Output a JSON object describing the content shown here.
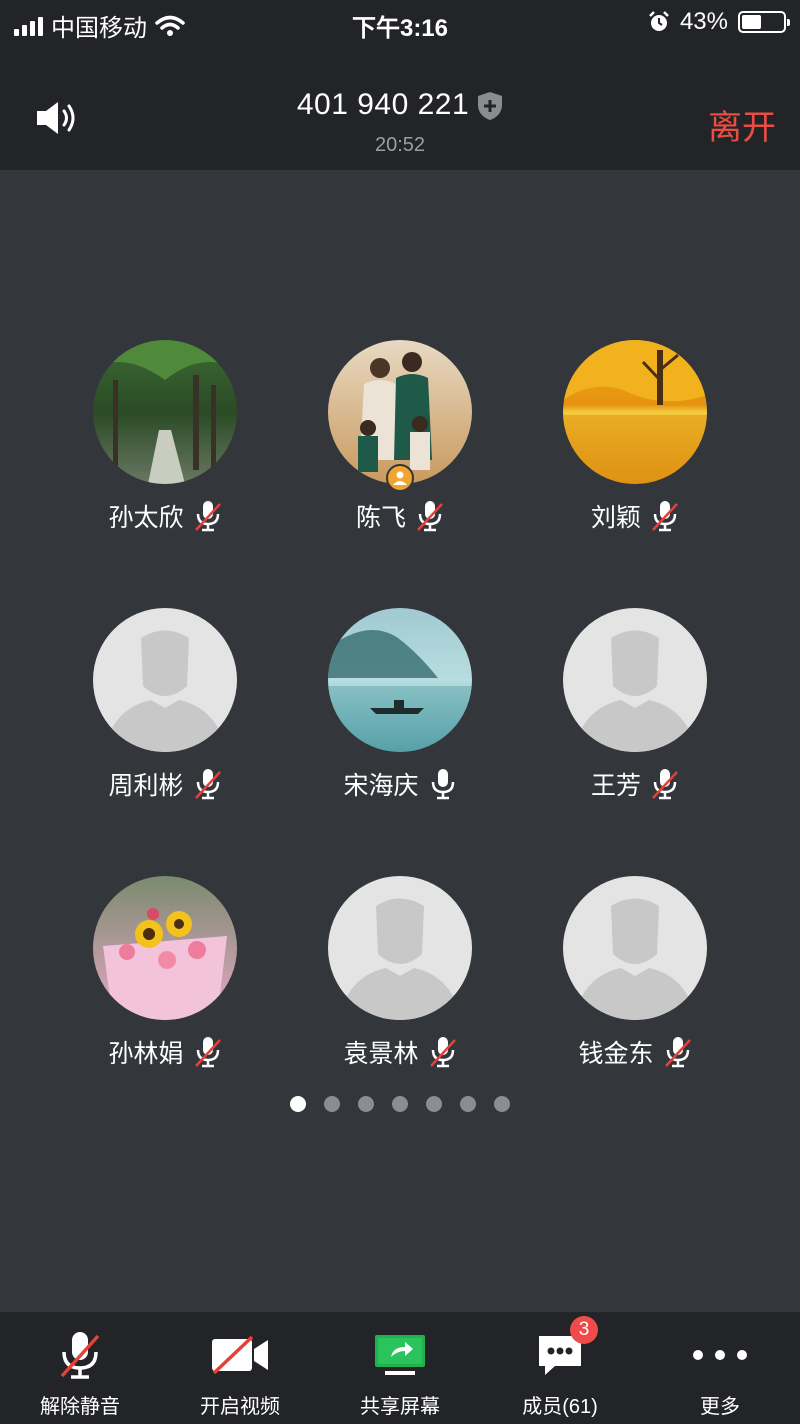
{
  "status_bar": {
    "carrier": "中国移动",
    "time": "下午3:16",
    "battery": "43%",
    "battery_level": 0.43
  },
  "header": {
    "meeting_id": "401 940 221",
    "duration": "20:52",
    "leave_label": "离开",
    "leave_color": "#ea4d43"
  },
  "participants": [
    {
      "name": "孙太欣",
      "mic": "muted",
      "avatar": "forest-path-photo"
    },
    {
      "name": "陈飞",
      "mic": "muted",
      "avatar": "family-photo",
      "host": true
    },
    {
      "name": "刘颖",
      "mic": "muted",
      "avatar": "autumn-tree-photo"
    },
    {
      "name": "周利彬",
      "mic": "muted",
      "avatar": "default-person"
    },
    {
      "name": "宋海庆",
      "mic": "on",
      "avatar": "misty-lake-boat-photo"
    },
    {
      "name": "王芳",
      "mic": "muted",
      "avatar": "default-person"
    },
    {
      "name": "孙林娟",
      "mic": "muted",
      "avatar": "flower-bouquet-photo"
    },
    {
      "name": "袁景林",
      "mic": "muted",
      "avatar": "default-person"
    },
    {
      "name": "钱金东",
      "mic": "muted",
      "avatar": "default-person"
    }
  ],
  "pager": {
    "pages": 7,
    "current": 1
  },
  "toolbar": {
    "unmute": "解除静音",
    "video": "开启视频",
    "share": "共享屏幕",
    "members": "成员(61)",
    "members_badge": "3",
    "more": "更多"
  }
}
